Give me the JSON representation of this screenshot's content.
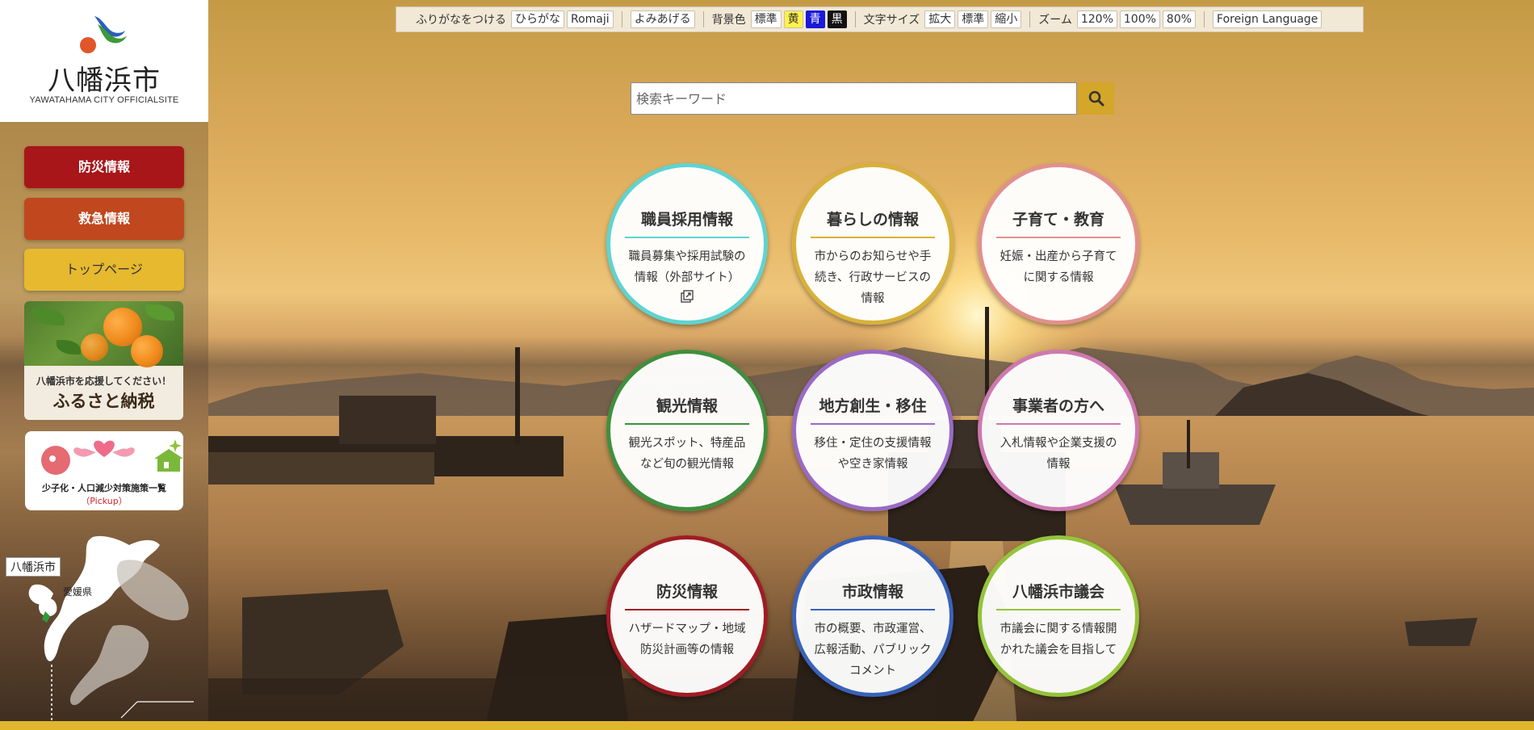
{
  "site": {
    "name": "八幡浜市",
    "subtitle": "YAWATAHAMA CITY OFFICIALSITE"
  },
  "toolbar": {
    "furigana_label": "ふりがなをつける",
    "hiragana": "ひらがな",
    "romaji": "Romaji",
    "read_aloud": "よみあげる",
    "bg_label": "背景色",
    "bg_standard": "標準",
    "bg_yellow": "黄",
    "bg_blue": "青",
    "bg_black": "黒",
    "font_label": "文字サイズ",
    "font_large": "拡大",
    "font_standard": "標準",
    "font_small": "縮小",
    "zoom_label": "ズーム",
    "zoom_120": "120%",
    "zoom_100": "100%",
    "zoom_80": "80%",
    "foreign": "Foreign Language"
  },
  "search": {
    "placeholder": "検索キーワード"
  },
  "sidebar": {
    "bousai": "防災情報",
    "kyukyu": "救急情報",
    "top": "トップページ",
    "furusato_caption": "八幡浜市を応援してください！",
    "furusato_title": "ふるさと納税",
    "shoshika_title": "少子化・人口減少対策施策一覧",
    "shoshika_pickup": "（Pickup）",
    "map_city": "八幡浜市",
    "map_pref": "愛媛県"
  },
  "menu": [
    {
      "title": "職員採用情報",
      "desc": "職員募集や採用試験の情報（外部サイト）",
      "color": "#5ed4d0"
    },
    {
      "title": "暮らしの情報",
      "desc": "市からのお知らせや手続き、行政サービスの情報",
      "color": "#d8b13a"
    },
    {
      "title": "子育て・教育",
      "desc": "妊娠・出産から子育てに関する情報",
      "color": "#e2908e"
    },
    {
      "title": "観光情報",
      "desc": "観光スポット、特産品など旬の観光情報",
      "color": "#3f8f3e"
    },
    {
      "title": "地方創生・移住",
      "desc": "移住・定住の支援情報や空き家情報",
      "color": "#9a6ac6"
    },
    {
      "title": "事業者の方へ",
      "desc": "入札情報や企業支援の情報",
      "color": "#cf78b0"
    },
    {
      "title": "防災情報",
      "desc": "ハザードマップ・地域防災計画等の情報",
      "color": "#a01c24"
    },
    {
      "title": "市政情報",
      "desc": "市の概要、市政運営、広報活動、パブリックコメント",
      "color": "#3a62b8"
    },
    {
      "title": "八幡浜市議会",
      "desc": "市議会に関する情報開かれた議会を目指して",
      "color": "#94c43a"
    }
  ]
}
